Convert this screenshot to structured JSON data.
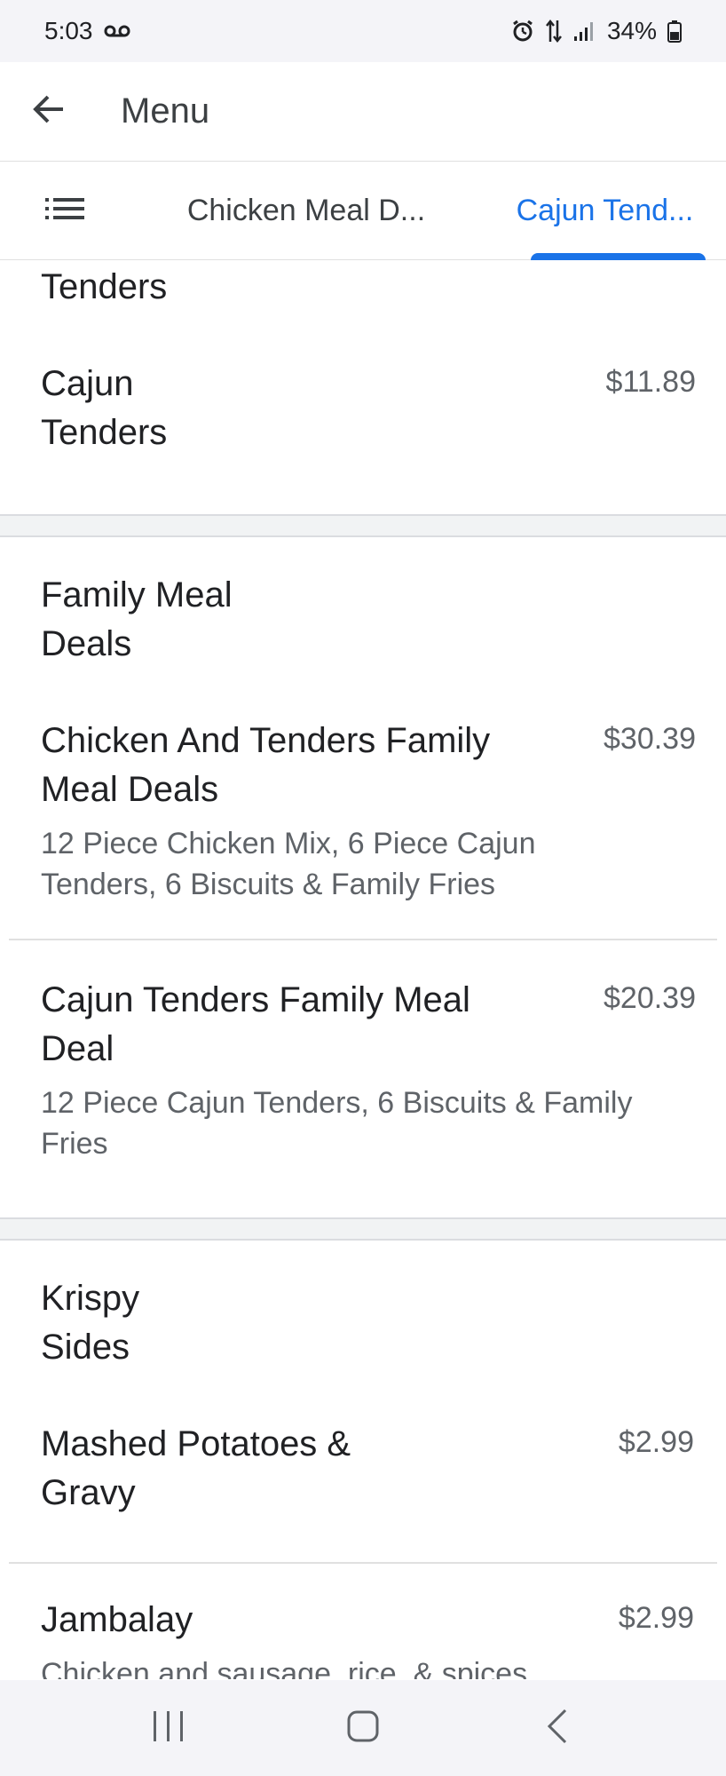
{
  "status": {
    "time": "5:03",
    "battery": "34%"
  },
  "header": {
    "title": "Menu"
  },
  "tabs": [
    {
      "label": "Chicken Meal D..."
    },
    {
      "label": "Cajun Tend..."
    }
  ],
  "sections": {
    "cajun": {
      "title": "Cajun\nTenders",
      "items": [
        {
          "name": "Cajun\nTenders",
          "price": "$11.89"
        }
      ]
    },
    "family": {
      "title": "Family Meal\nDeals",
      "items": [
        {
          "name": "Chicken And Tenders Family\nMeal Deals",
          "price": "$30.39",
          "desc": "12 Piece Chicken Mix, 6 Piece Cajun\nTenders, 6 Biscuits & Family Fries"
        },
        {
          "name": "Cajun Tenders Family Meal\nDeal",
          "price": "$20.39",
          "desc": "12 Piece Cajun Tenders, 6 Biscuits & Family\nFries"
        }
      ]
    },
    "sides": {
      "title": "Krispy\nSides",
      "items": [
        {
          "name": "Mashed Potatoes &\nGravy",
          "price": "$2.99"
        },
        {
          "name": "Jambalay",
          "price": "$2.99",
          "desc": "Chicken and sausage, rice, & spices"
        }
      ]
    }
  },
  "icons": {
    "back": "back-arrow-icon",
    "list": "list-icon",
    "voicemail": "voicemail-icon",
    "alarm": "alarm-icon",
    "data": "data-transfer-icon",
    "signal": "signal-icon",
    "battery": "battery-icon"
  },
  "colors": {
    "accent": "#1a73e8",
    "text": "#202124",
    "secondary": "#5f6368"
  }
}
